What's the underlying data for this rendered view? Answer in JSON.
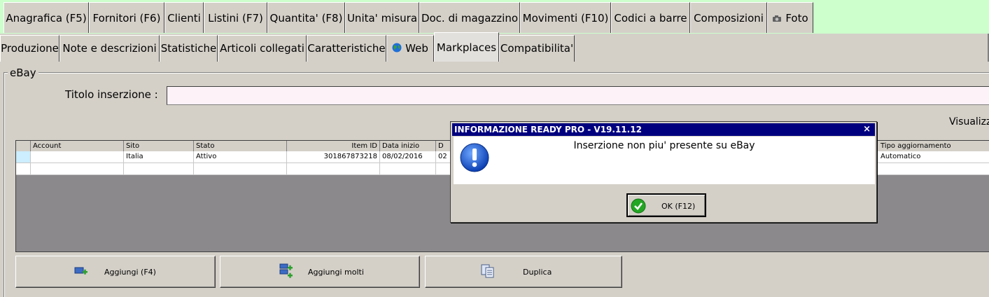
{
  "tabs_row1": [
    {
      "label": "Anagrafica (F5)"
    },
    {
      "label": "Fornitori (F6)"
    },
    {
      "label": "Clienti"
    },
    {
      "label": "Listini (F7)"
    },
    {
      "label": "Quantita' (F8)"
    },
    {
      "label": "Unita' misura"
    },
    {
      "label": "Doc. di magazzino"
    },
    {
      "label": "Movimenti (F10)"
    },
    {
      "label": "Codici a barre"
    },
    {
      "label": "Composizioni"
    },
    {
      "label": "Foto",
      "icon": "camera-icon"
    }
  ],
  "tabs_row2": [
    {
      "label": "Produzione"
    },
    {
      "label": "Note e descrizioni"
    },
    {
      "label": "Statistiche"
    },
    {
      "label": "Articoli collegati"
    },
    {
      "label": "Caratteristiche"
    },
    {
      "label": "Web",
      "icon": "globe-icon"
    },
    {
      "label": "Markplaces",
      "active": true
    },
    {
      "label": "Compatibilita'"
    }
  ],
  "group": {
    "label": "eBay"
  },
  "titolo": {
    "label": "Titolo inserzione :",
    "value": ""
  },
  "visualizza": {
    "label": "Visualizz"
  },
  "grid": {
    "columns": [
      "Account",
      "Sito",
      "Stato",
      "Item ID",
      "Data inizio",
      "D",
      "Tipo aggiornamento"
    ],
    "rows": [
      [
        "",
        "Italia",
        "Attivo",
        "301867873218",
        "08/02/2016",
        "02",
        "Automatico"
      ]
    ]
  },
  "buttons": {
    "add": "Aggiungi (F4)",
    "add_many": "Aggiungi molti",
    "duplicate": "Duplica"
  },
  "dialog": {
    "title": "INFORMAZIONE READY PRO - V19.11.12",
    "close": "×",
    "message": "Inserzione non piu' presente su eBay",
    "ok": "OK (F12)"
  },
  "colors": {
    "tab_strip_bg": "#ccffcc",
    "dialog_title_bg": "#00007f",
    "grid_bg": "#8b898b"
  }
}
